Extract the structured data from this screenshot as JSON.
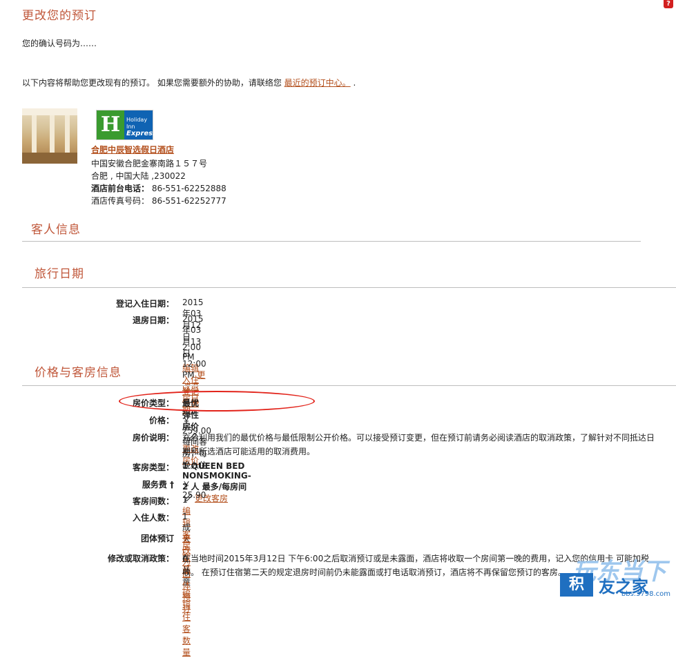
{
  "help_badge": "?",
  "header": {
    "title": "更改您的预订",
    "confirmation": "您的确认号码为……",
    "help_text": "以下内容将帮助您更改现有的预订。 如果您需要额外的协助，请联络您 ",
    "help_link": "最近的预订中心。",
    "help_suffix": " ."
  },
  "hotel": {
    "logo": {
      "mark": "H",
      "line1": "Holiday Inn",
      "line2": "Express"
    },
    "name": "合肥中辰智选假日酒店",
    "address1": "中国安徽合肥金寨南路１５７号",
    "address2": "合肥 , 中国大陆 ,230022",
    "phone_label": "酒店前台电话：",
    "phone": " 86-551-62252888",
    "fax_label": "酒店传真号码：",
    "fax": " 86-551-62252777"
  },
  "sections": {
    "guest": "客人信息",
    "dates": "旅行日期",
    "price": "价格与客房信息"
  },
  "dates": {
    "checkin_label": "登记入住日期：",
    "checkin_value": "2015年03月12日 2:00 PM ",
    "checkin_link": "编辑入住登记日期",
    "checkout_label": "退房日期：",
    "checkout_value": "2015年03月13日 12:00 PM ",
    "checkout_link": "更改退房日期"
  },
  "price": {
    "rate_type_label": "房价类型：",
    "rate_type_value": "最优弹性房价",
    "rate_type_link": "更改房价",
    "price_label": "价格：",
    "price_value": "￥ 259.00   每间客房，每晚入住",
    "desc_label": "房价说明：",
    "desc_value1": "充分利用我们的最优价格与最低限制公开价格。可以接受预订变更，但在预订前请务必阅读酒店的取消政策，了解针对不同抵达日",
    "desc_value2": "期和所选酒店可能适用的取消费用。",
    "room_type_label": "客房类型：",
    "room_type_value": "1 QUEEN BED NONSMOKING- 2 人 最多/每房间",
    "room_type_link": "更改客房",
    "service_label": "服务费 †",
    "service_value": "￥ 25.90",
    "rooms_label": "客房间数：",
    "rooms_value": "1 ",
    "rooms_link": "编辑客房数量",
    "guests_label": "入住人数：",
    "guests_value": "1 成人 , 0 儿童 ",
    "guests_link": "编辑住客数量",
    "group_label": "团体预订",
    "group_link": "更改为团体预订",
    "cancel_label": "修改或取消政策：",
    "cancel_value1": "在当地时间2015年3月12日 下午6:00之后取消预订或是未露面，酒店将收取一个房间第一晚的费用，记入您的信用卡 可能加税",
    "cancel_value2": "收。 在预订住宿第二天的规定退房时间前仍未能露面或打电话取消预订，酒店将不再保留您预订的客房。"
  },
  "watermark": {
    "big": "玩东当下",
    "block": "积",
    "mid": "友之家",
    "url": "bbs.3798.com"
  }
}
